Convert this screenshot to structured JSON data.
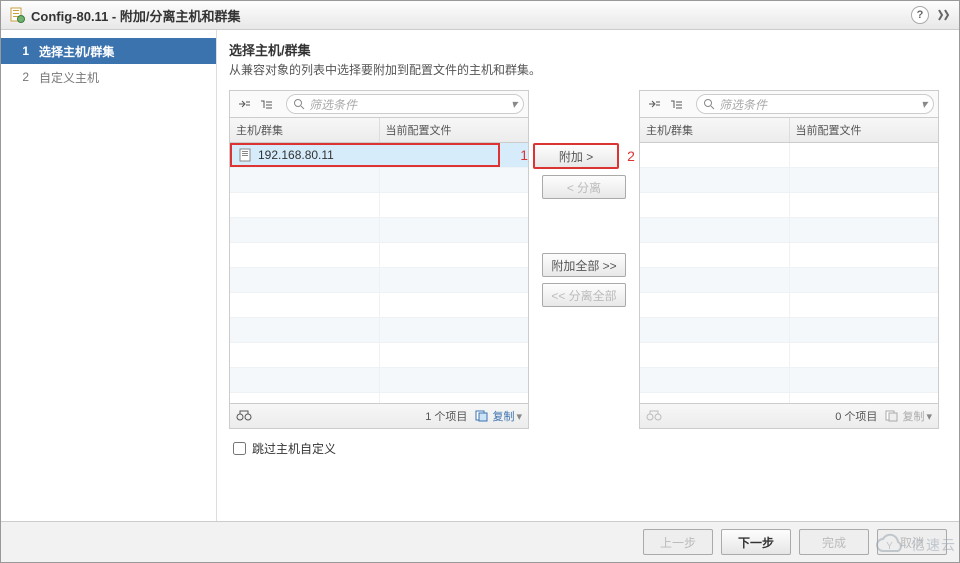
{
  "title": "Config-80.11 - 附加/分离主机和群集",
  "sidebar": {
    "steps": [
      {
        "num": "1",
        "label": "选择主机/群集"
      },
      {
        "num": "2",
        "label": "自定义主机"
      }
    ]
  },
  "main": {
    "heading": "选择主机/群集",
    "desc": "从兼容对象的列表中选择要附加到配置文件的主机和群集。"
  },
  "panel": {
    "filter_placeholder": "筛选条件",
    "col_host": "主机/群集",
    "col_profile": "当前配置文件",
    "left": {
      "rows": [
        {
          "host": "192.168.80.11",
          "profile": ""
        }
      ],
      "count": "1 个项目",
      "copy": "复制"
    },
    "right": {
      "count": "0 个项目",
      "copy": "复制"
    }
  },
  "buttons": {
    "attach": "附加 >",
    "detach": "< 分离",
    "attach_all": "附加全部 >>",
    "detach_all": "<< 分离全部"
  },
  "annotations": {
    "one": "1",
    "two": "2"
  },
  "skip": "跳过主机自定义",
  "footer": {
    "back": "上一步",
    "next": "下一步",
    "finish": "完成",
    "cancel": "取消"
  },
  "watermark": "亿速云"
}
